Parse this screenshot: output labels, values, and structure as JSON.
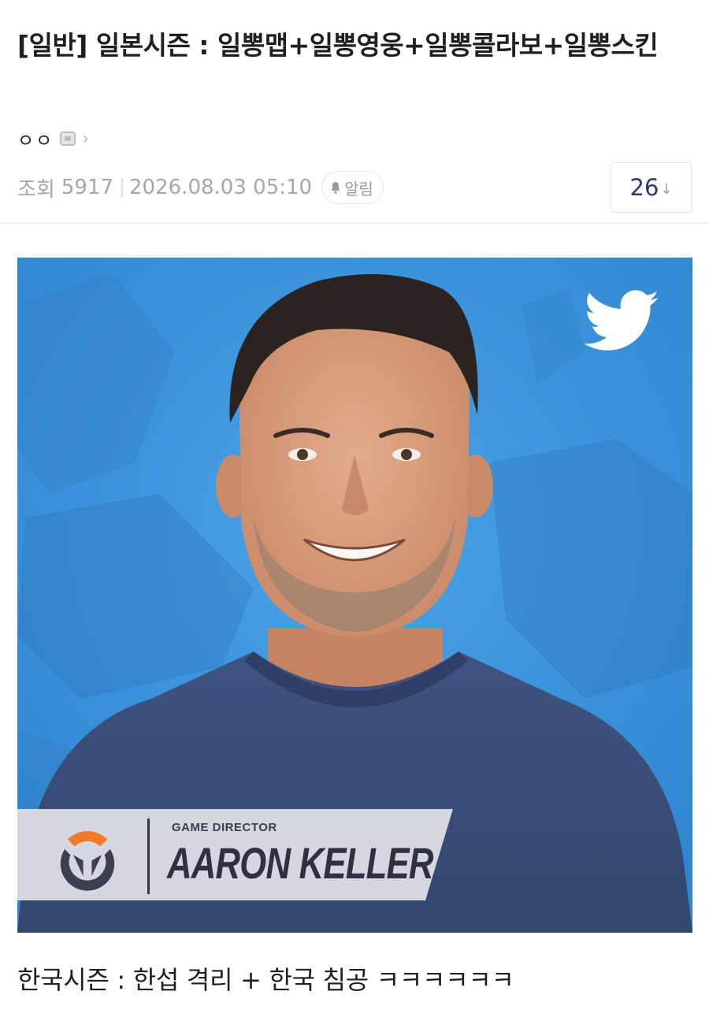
{
  "post": {
    "title": "[일반] 일본시즌 : 일뽕맵+일뽕영웅+일뽕콜라보+일뽕스킨",
    "author": "ㅇㅇ",
    "views_label": "조회",
    "views": "5917",
    "datetime": "2026.08.03 05:10",
    "notify_label": "알림",
    "comment_count": "26",
    "comment_arrow": "↓",
    "body_text": "한국시즌 : 한섭 격리 + 한국 침공 ㅋㅋㅋㅋㅋㅋ"
  },
  "image": {
    "role_text": "GAME DIRECTOR",
    "name_text": "AARON KELLER",
    "background_color": "#3f97de",
    "shirt_color": "#3b4f7a",
    "nameplate_color": "#d4d7e0",
    "logo_accent_color": "#f07b2b",
    "icons": [
      "twitter-bird-icon",
      "overwatch-logo-icon"
    ]
  },
  "icons": {
    "author_badge": "badge-icon",
    "author_chevron": "chevron-right-icon",
    "notify": "bell-icon"
  }
}
